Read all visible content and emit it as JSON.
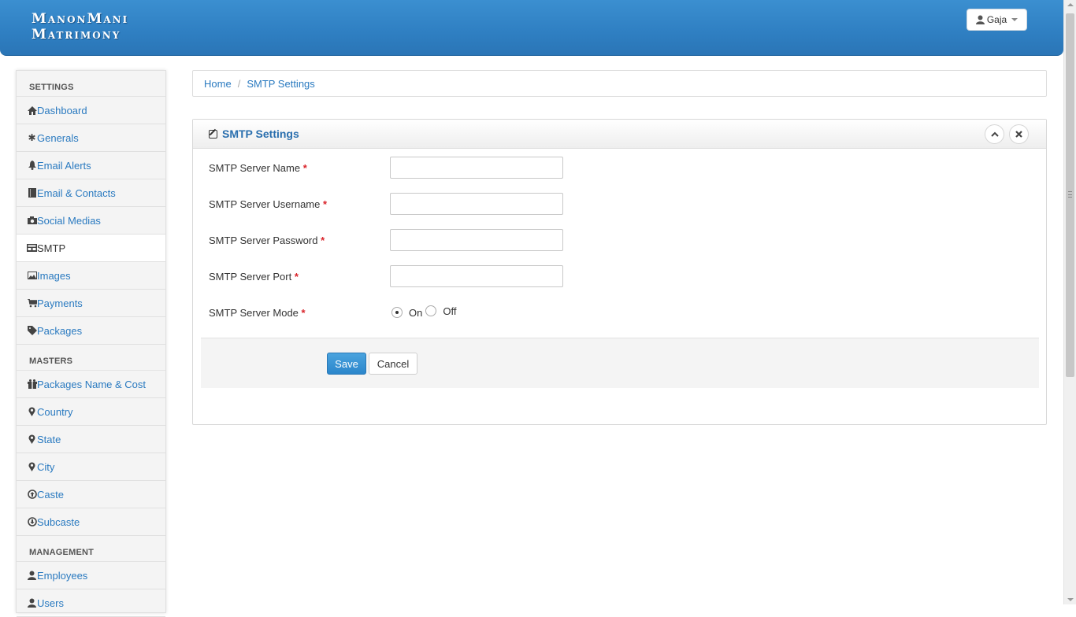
{
  "header": {
    "logo_line1": "ManonMani",
    "logo_line2": "Matrimony",
    "user_name": "Gaja",
    "user_icon": "user-icon"
  },
  "sidebar": {
    "sections": [
      {
        "title": "SETTINGS",
        "items": [
          {
            "label": "Dashboard",
            "icon": "home-icon"
          },
          {
            "label": "Generals",
            "icon": "gear-icon"
          },
          {
            "label": "Email Alerts",
            "icon": "bell-icon"
          },
          {
            "label": "Email & Contacts",
            "icon": "book-icon"
          },
          {
            "label": "Social Medias",
            "icon": "camera-icon"
          },
          {
            "label": "SMTP",
            "icon": "inbox-icon",
            "active": true
          },
          {
            "label": "Images",
            "icon": "picture-icon"
          },
          {
            "label": "Payments",
            "icon": "cart-icon"
          },
          {
            "label": "Packages",
            "icon": "tag-icon"
          }
        ]
      },
      {
        "title": "MASTERS",
        "items": [
          {
            "label": "Packages Name & Cost",
            "icon": "gift-icon"
          },
          {
            "label": "Country",
            "icon": "map-marker-icon"
          },
          {
            "label": "State",
            "icon": "map-marker-icon"
          },
          {
            "label": "City",
            "icon": "map-marker-icon"
          },
          {
            "label": "Caste",
            "icon": "circle-arrow-up-icon"
          },
          {
            "label": "Subcaste",
            "icon": "circle-arrow-down-icon"
          }
        ]
      },
      {
        "title": "MANAGEMENT",
        "items": [
          {
            "label": "Employees",
            "icon": "user-icon"
          },
          {
            "label": "Users",
            "icon": "user-icon"
          }
        ]
      }
    ]
  },
  "breadcrumb": {
    "home": "Home",
    "separator": "/",
    "current": "SMTP Settings"
  },
  "panel": {
    "title": "SMTP Settings",
    "title_icon": "edit-icon",
    "collapse_icon": "chevron-up-icon",
    "close_icon": "close-icon",
    "fields": [
      {
        "label": "SMTP Server Name",
        "required": "*",
        "value": ""
      },
      {
        "label": "SMTP Server Username",
        "required": "*",
        "value": ""
      },
      {
        "label": "SMTP Server Password",
        "required": "*",
        "value": ""
      },
      {
        "label": "SMTP Server Port",
        "required": "*",
        "value": ""
      }
    ],
    "mode": {
      "label": "SMTP Server Mode",
      "required": "*",
      "options": [
        "On",
        "Off"
      ],
      "selected": "On"
    },
    "save_label": "Save",
    "cancel_label": "Cancel"
  },
  "colors": {
    "header": "#2f7fc2",
    "link": "#2a7ac0",
    "required": "#d9232a",
    "primary_button": "#2b86cb"
  }
}
